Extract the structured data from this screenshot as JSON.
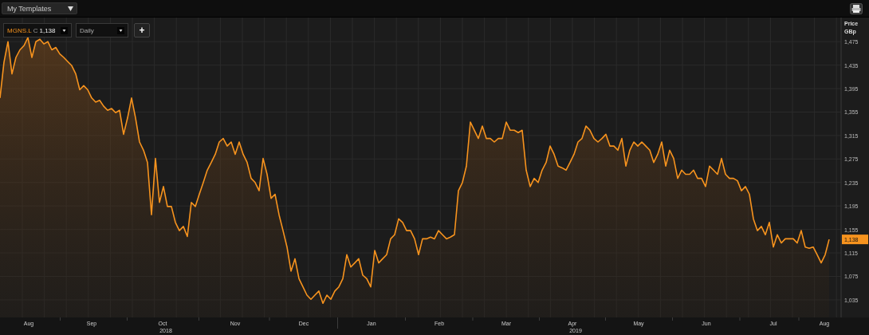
{
  "top_bar": {
    "template_menu": "My Templates"
  },
  "chart": {
    "instrument": {
      "ticker": "MGNS.L",
      "close_label": "C",
      "close_value": "1,138"
    },
    "interval": "Daily",
    "add_button": "+",
    "axis_title": [
      "Price",
      "GBp"
    ],
    "last_price": "1,138",
    "year_labels": [
      "2018",
      "2019"
    ],
    "month_labels": [
      "Aug",
      "Sep",
      "Oct",
      "Nov",
      "Dec",
      "Jan",
      "Feb",
      "Mar",
      "Apr",
      "May",
      "Jun",
      "Jul",
      "Aug"
    ],
    "chart_data": {
      "type": "area",
      "grid": true,
      "ylim": [
        1005,
        1516
      ],
      "yticks": [
        {
          "value": 1475,
          "label": "1,475"
        },
        {
          "value": 1435,
          "label": "1,435"
        },
        {
          "value": 1395,
          "label": "1,395"
        },
        {
          "value": 1355,
          "label": "1,355"
        },
        {
          "value": 1315,
          "label": "1,315"
        },
        {
          "value": 1275,
          "label": "1,275"
        },
        {
          "value": 1235,
          "label": "1,235"
        },
        {
          "value": 1195,
          "label": "1,195"
        },
        {
          "value": 1155,
          "label": "1,155"
        },
        {
          "value": 1115,
          "label": "1,115"
        },
        {
          "value": 1075,
          "label": "1,075"
        },
        {
          "value": 1035,
          "label": "1,035"
        }
      ],
      "series": [
        {
          "color": "#f7931e",
          "values": [
            1379,
            1440,
            1475,
            1420,
            1448,
            1461,
            1468,
            1482,
            1448,
            1475,
            1479,
            1471,
            1475,
            1461,
            1465,
            1454,
            1448,
            1441,
            1434,
            1420,
            1393,
            1400,
            1393,
            1379,
            1372,
            1375,
            1365,
            1358,
            1361,
            1354,
            1358,
            1317,
            1345,
            1379,
            1345,
            1304,
            1290,
            1269,
            1180,
            1276,
            1201,
            1228,
            1194,
            1194,
            1167,
            1153,
            1160,
            1143,
            1201,
            1194,
            1215,
            1235,
            1256,
            1269,
            1283,
            1304,
            1310,
            1297,
            1304,
            1283,
            1304,
            1283,
            1269,
            1242,
            1235,
            1221,
            1276,
            1249,
            1208,
            1215,
            1180,
            1153,
            1125,
            1084,
            1105,
            1071,
            1057,
            1043,
            1036,
            1043,
            1050,
            1029,
            1043,
            1036,
            1050,
            1057,
            1071,
            1112,
            1091,
            1098,
            1105,
            1077,
            1071,
            1057,
            1119,
            1098,
            1105,
            1112,
            1139,
            1146,
            1173,
            1167,
            1153,
            1153,
            1139,
            1112,
            1139,
            1139,
            1142,
            1139,
            1153,
            1146,
            1139,
            1142,
            1146,
            1221,
            1235,
            1263,
            1338,
            1324,
            1310,
            1331,
            1310,
            1310,
            1304,
            1310,
            1310,
            1338,
            1324,
            1324,
            1320,
            1324,
            1256,
            1228,
            1242,
            1235,
            1256,
            1269,
            1297,
            1283,
            1263,
            1260,
            1256,
            1269,
            1283,
            1304,
            1310,
            1331,
            1324,
            1310,
            1304,
            1310,
            1317,
            1297,
            1297,
            1290,
            1310,
            1263,
            1290,
            1304,
            1297,
            1304,
            1297,
            1290,
            1269,
            1283,
            1304,
            1263,
            1290,
            1276,
            1242,
            1256,
            1249,
            1249,
            1256,
            1242,
            1242,
            1228,
            1263,
            1256,
            1249,
            1276,
            1249,
            1242,
            1242,
            1238,
            1221,
            1228,
            1215,
            1173,
            1153,
            1160,
            1146,
            1167,
            1125,
            1146,
            1132,
            1139,
            1139,
            1139,
            1132,
            1153,
            1125,
            1123,
            1125,
            1112,
            1098,
            1112,
            1138
          ]
        }
      ]
    }
  }
}
